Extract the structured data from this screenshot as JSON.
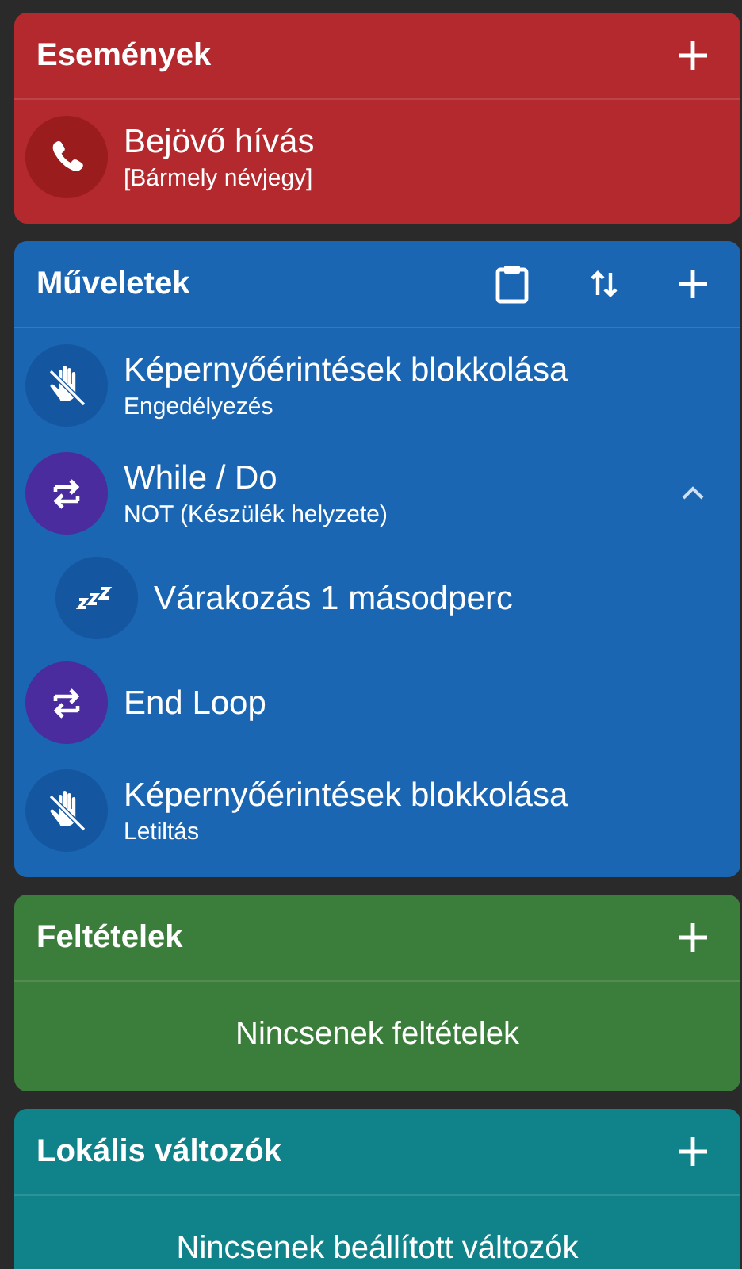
{
  "sections": [
    {
      "kind": "events",
      "title": "Események",
      "color": "#b3292d",
      "items": [
        {
          "kind": "call",
          "title": "Bejövő hívás",
          "subtitle": "[Bármely névjegy]"
        }
      ]
    },
    {
      "kind": "actions",
      "title": "Műveletek",
      "color": "#1a66b3",
      "items": [
        {
          "kind": "touch",
          "title": "Képernyőérintések blokkolása",
          "subtitle": "Engedélyezés"
        },
        {
          "kind": "loop",
          "title": "While / Do",
          "subtitle": "NOT (Készülék helyzete)",
          "expanded": true,
          "children": [
            {
              "kind": "wait",
              "title": "Várakozás 1 másodperc"
            }
          ]
        },
        {
          "kind": "loop",
          "title": "End Loop"
        },
        {
          "kind": "touch",
          "title": "Képernyőérintések blokkolása",
          "subtitle": "Letiltás"
        }
      ]
    },
    {
      "kind": "conditions",
      "title": "Feltételek",
      "color": "#3b7d3b",
      "empty_text": "Nincsenek feltételek"
    },
    {
      "kind": "variables",
      "title": "Lokális változók",
      "color": "#10828a",
      "empty_text": "Nincsenek beállított változók"
    }
  ]
}
